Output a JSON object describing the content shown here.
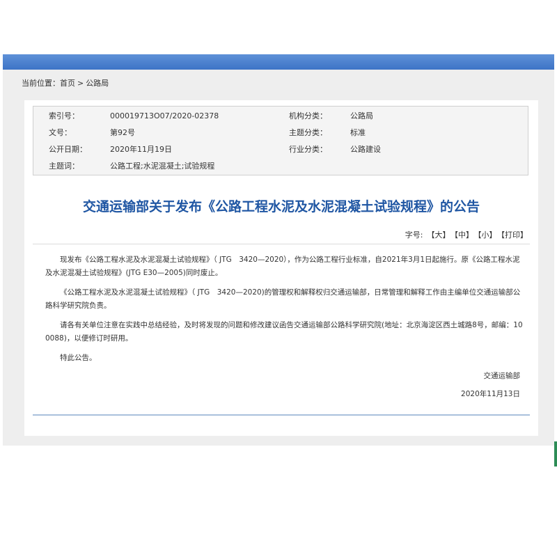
{
  "breadcrumb": {
    "prefix": "当前位置：",
    "home": "首页",
    "separator": ">",
    "current": "公路局"
  },
  "meta": {
    "index_label": "索引号：",
    "index_value": "000019713O07/2020-02378",
    "org_label": "机构分类：",
    "org_value": "公路局",
    "doc_no_label": "文号：",
    "doc_no_value": "第92号",
    "topic_label": "主题分类：",
    "topic_value": "标准",
    "date_label": "公开日期：",
    "date_value": "2020年11月19日",
    "industry_label": "行业分类：",
    "industry_value": "公路建设",
    "keywords_label": "主题词：",
    "keywords_value": "公路工程;水泥混凝土;试验规程"
  },
  "article": {
    "title": "交通运输部关于发布《公路工程水泥及水泥混凝土试验规程》的公告",
    "paragraphs": [
      "现发布《公路工程水泥及水泥混凝土试验规程》（ JTG　3420—2020），作为公路工程行业标准，自2021年3月1日起施行。原《公路工程水泥及水泥混凝土试验规程》(JTG E30—2005)同时废止。",
      "《公路工程水泥及水泥混凝土试验规程》（ JTG　3420—2020)的管理权和解释权归交通运输部，日常管理和解释工作由主编单位交通运输部公路科学研究院负责。",
      "请各有关单位注意在实践中总结经验，及时将发现的问题和修改建议函告交通运输部公路科学研究院(地址：北京海淀区西土城路8号，邮编：100088)，以便修订时研用。",
      "特此公告。"
    ],
    "signature_org": "交通运输部",
    "signature_date": "2020年11月13日"
  },
  "fontsize": {
    "label": "字号:",
    "large": "【大】",
    "medium": "【中】",
    "small": "【小】",
    "print": "【打印】"
  }
}
